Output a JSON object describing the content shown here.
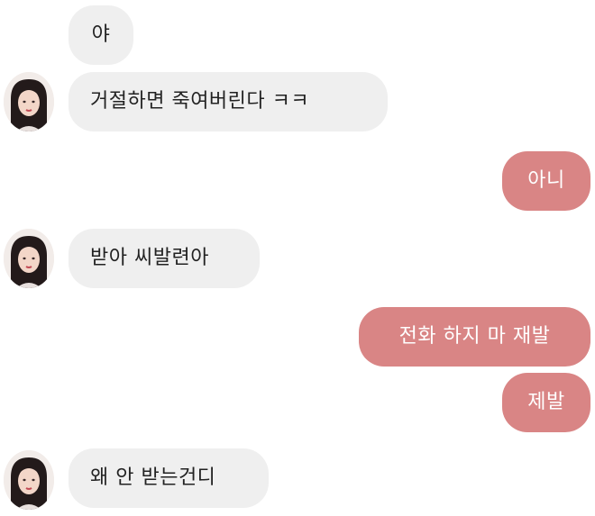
{
  "messages": [
    {
      "side": "received",
      "text": "야"
    },
    {
      "side": "received",
      "text": "거절하면 죽여버린다 ㅋㅋ"
    },
    {
      "side": "sent",
      "text": "아니"
    },
    {
      "side": "received",
      "text": "받아 씨발련아"
    },
    {
      "side": "sent",
      "text": "전화 하지 마 재발"
    },
    {
      "side": "sent",
      "text": "제발"
    },
    {
      "side": "received",
      "text": "왜 안 받는건디"
    }
  ],
  "colors": {
    "received_bubble": "#efefef",
    "sent_bubble": "#d98585",
    "received_text": "#222222",
    "sent_text": "#ffffff",
    "background": "#ffffff"
  },
  "icons": {
    "avatar": "profile-photo-girl"
  }
}
